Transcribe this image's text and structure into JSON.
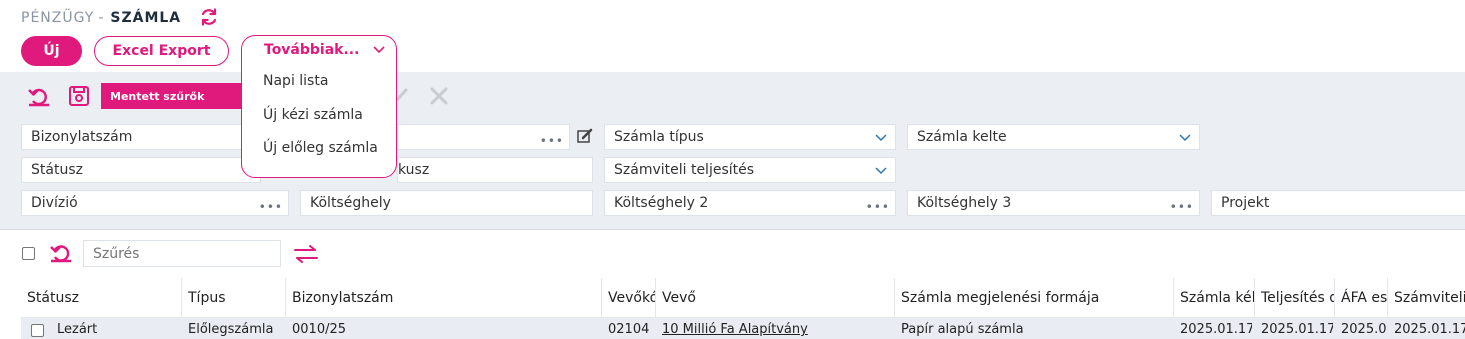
{
  "header": {
    "breadcrumb_parent": "PÉNZÜGY",
    "breadcrumb_sep": "-",
    "breadcrumb_current": "SZÁMLA"
  },
  "toolbar": {
    "new_label": "Új",
    "excel_label": "Excel Export",
    "more_label": "Továbbiak..."
  },
  "more_menu": {
    "items": [
      "Napi lista",
      "Új kézi számla",
      "Új előleg számla"
    ]
  },
  "filter_panel": {
    "saved_filters_label": "Mentett szűrők",
    "fields": {
      "bizonylatszam": "Bizonylatszám",
      "szamla_tipus": "Számla típus",
      "szamla_kelte": "Számla kelte",
      "statusz": "Státusz",
      "hidden_status_tail": "kusz",
      "szamviteli_teljesites": "Számviteli teljesítés",
      "divizio": "Divízió",
      "koltseghely": "Költséghely",
      "koltseghely2": "Költséghely 2",
      "koltseghely3": "Költséghely 3",
      "projekt": "Projekt"
    }
  },
  "list": {
    "filter_placeholder": "Szűrés",
    "columns": [
      "Státusz",
      "Típus",
      "Bizonylatszám",
      "Vevőkó",
      "Vevő",
      "Számla megjelenési formája",
      "Számla kél",
      "Teljesítés d",
      "ÁFA es",
      "Számviteli"
    ],
    "rows": [
      [
        "Lezárt",
        "Előlegszámla",
        "0010/25",
        "02104",
        "10 Millió Fa Alapítvány",
        "Papír alapú számla",
        "2025.01.17.",
        "2025.01.17.",
        "2025.0",
        "2025.01.17."
      ]
    ]
  },
  "colors": {
    "accent": "#e0197d",
    "panel_bg": "#ebeef2",
    "row_bg": "#e9edf3"
  },
  "icons": [
    "refresh-icon",
    "reset-icon",
    "save-icon",
    "edit-icon",
    "close-icon",
    "swap-icon",
    "chevron-down-icon",
    "ellipsis-icon"
  ]
}
